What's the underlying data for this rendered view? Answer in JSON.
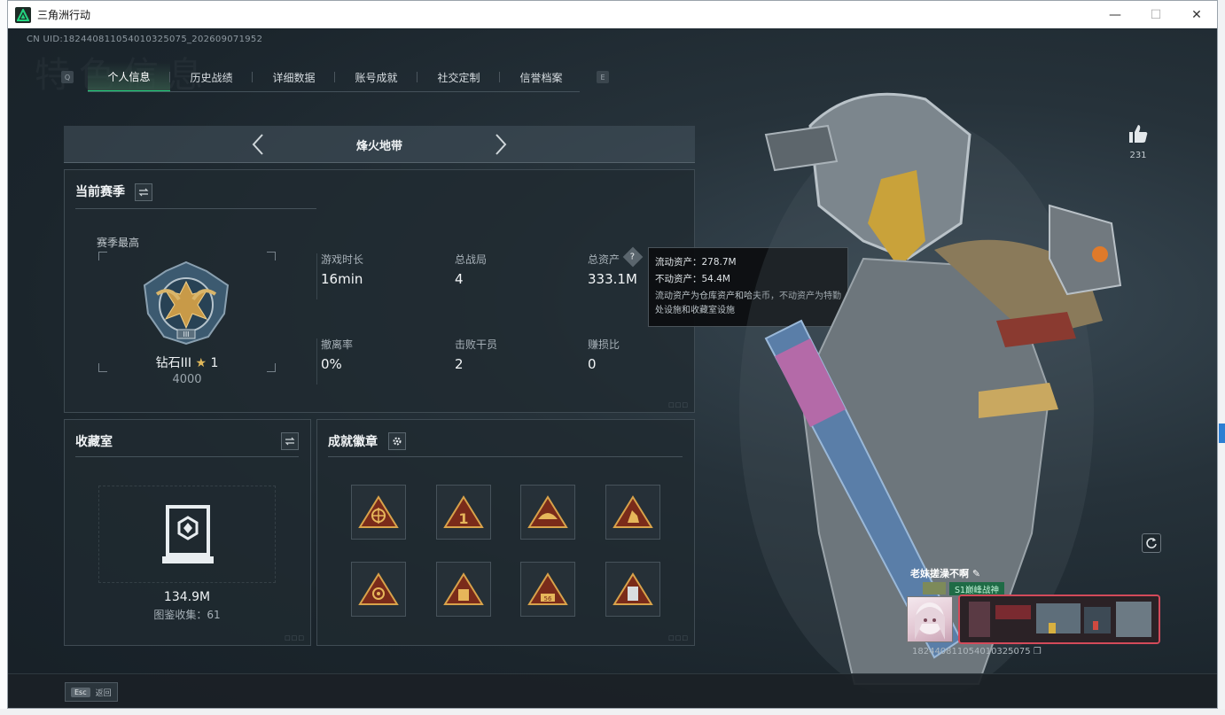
{
  "window": {
    "title": "三角洲行动",
    "controls": [
      "—",
      "☐",
      "✕"
    ]
  },
  "uid_line": "CN UID:182440811054010325075_202609071952",
  "bg_watermark": "特色信息",
  "tabs": {
    "left_key": "Q",
    "right_key": "E",
    "items": [
      {
        "label": "个人信息",
        "active": true
      },
      {
        "label": "历史战绩",
        "active": false
      },
      {
        "label": "详细数据",
        "active": false
      },
      {
        "label": "账号成就",
        "active": false
      },
      {
        "label": "社交定制",
        "active": false
      },
      {
        "label": "信誉档案",
        "active": false
      }
    ]
  },
  "mode": {
    "title": "烽火地带"
  },
  "season": {
    "title": "当前赛季",
    "peak_label": "赛季最高",
    "rank_name": "钻石III",
    "rank_stars": "1",
    "rank_points": "4000",
    "stats": [
      {
        "label": "游戏时长",
        "value": "16min"
      },
      {
        "label": "总战局",
        "value": "4"
      },
      {
        "label": "总资产",
        "value": "333.1M"
      },
      {
        "label": "撤离率",
        "value": "0%"
      },
      {
        "label": "击败干员",
        "value": "2"
      },
      {
        "label": "赚损比",
        "value": "0"
      }
    ]
  },
  "tooltip": {
    "liquid": "流动资产：278.7M",
    "fixed": "不动资产：54.4M",
    "note": "流动资产为仓库资产和哈夫币，不动资产为特勤处设施和收藏室设施"
  },
  "collection": {
    "title": "收藏室",
    "value": "134.9M",
    "catalog": "图鉴收集：61"
  },
  "achievements": {
    "title": "成就徽章",
    "badges": [
      "badge-1",
      "badge-2",
      "badge-3",
      "badge-4",
      "badge-5",
      "badge-6",
      "badge-7",
      "badge-8"
    ]
  },
  "like": {
    "count": "231"
  },
  "namecard": {
    "name": "老妹搓澡不啊",
    "title": "S1巅峰战神",
    "uid": "182440811054010325075"
  },
  "bottom": {
    "esc_key": "Esc",
    "esc_label": "返回"
  },
  "colors": {
    "accent": "#1fd37d",
    "gold": "#c8a25a"
  }
}
